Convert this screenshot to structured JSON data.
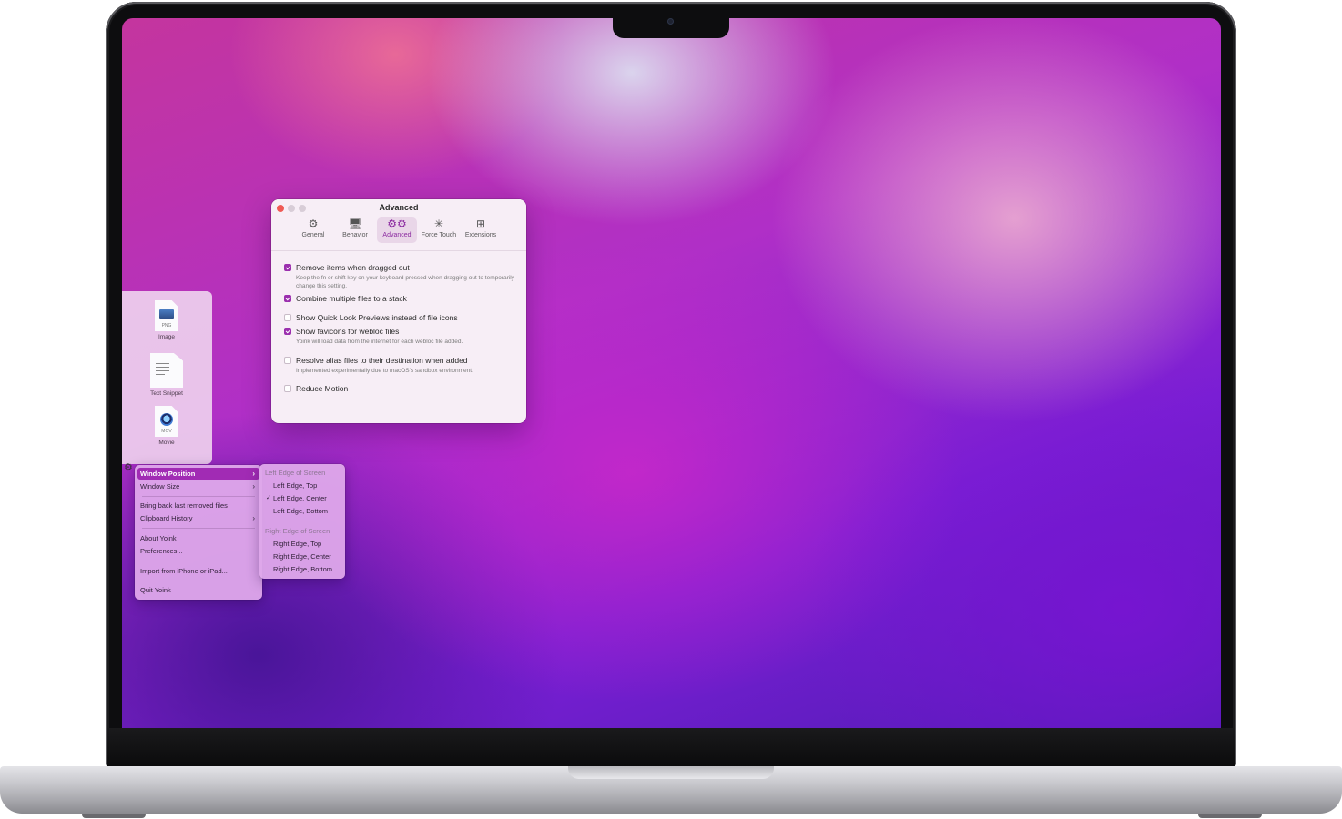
{
  "prefs_window": {
    "title": "Advanced",
    "tabs": [
      {
        "label": "General",
        "icon": "gear-icon",
        "active": false
      },
      {
        "label": "Behavior",
        "icon": "monitor-icon",
        "active": false
      },
      {
        "label": "Advanced",
        "icon": "gears-icon",
        "active": true
      },
      {
        "label": "Force Touch",
        "icon": "force-touch-icon",
        "active": false
      },
      {
        "label": "Extensions",
        "icon": "extensions-icon",
        "active": false
      }
    ],
    "options": [
      {
        "label": "Remove items when dragged out",
        "checked": true,
        "description": "Keep the fn or shift key on your keyboard pressed when dragging out to temporarily change this setting."
      },
      {
        "label": "Combine multiple files to a stack",
        "checked": true,
        "description": ""
      },
      {
        "label": "Show Quick Look Previews instead of file icons",
        "checked": false,
        "description": ""
      },
      {
        "label": "Show favicons for webloc files",
        "checked": true,
        "description": "Yoink will load data from the internet for each webloc file added."
      },
      {
        "label": "Resolve alias files to their destination when added",
        "checked": false,
        "description": "Implemented experimentally due to macOS's sandbox environment."
      },
      {
        "label": "Reduce Motion",
        "checked": false,
        "description": ""
      }
    ]
  },
  "shelf": {
    "files": [
      {
        "label": "Image",
        "badge": "PNG",
        "icon": "png-file-icon"
      },
      {
        "label": "Text Snippet",
        "badge": "",
        "icon": "text-file-icon"
      },
      {
        "label": "Movie",
        "badge": "MOV",
        "icon": "mov-file-icon"
      }
    ]
  },
  "context_menu": {
    "items": {
      "window_position": "Window Position",
      "window_size": "Window Size",
      "bring_back": "Bring back last removed files",
      "clipboard_history": "Clipboard History",
      "about": "About Yoink",
      "preferences": "Preferences...",
      "import": "Import from iPhone or iPad...",
      "quit": "Quit Yoink"
    },
    "submenu": {
      "left_header": "Left Edge of Screen",
      "left_top": "Left Edge, Top",
      "left_center": "Left Edge, Center",
      "left_bottom": "Left Edge, Bottom",
      "right_header": "Right Edge of Screen",
      "right_top": "Right Edge, Top",
      "right_center": "Right Edge, Center",
      "right_bottom": "Right Edge, Bottom",
      "selected": "Left Edge, Center"
    }
  },
  "colors": {
    "accent": "#9b2fae",
    "menu_highlight": "#a12bb4",
    "window_bg": "#f7eef6"
  }
}
